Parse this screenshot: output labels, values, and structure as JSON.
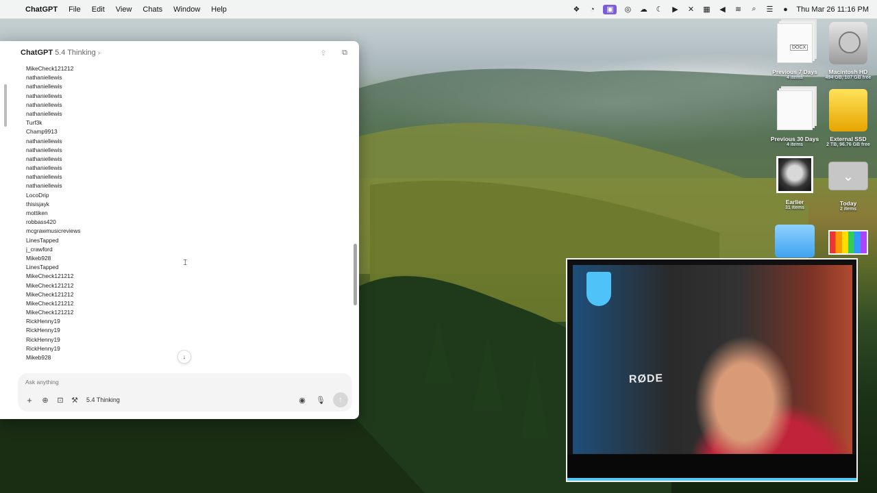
{
  "menubar": {
    "app_name": "ChatGPT",
    "items": [
      "File",
      "Edit",
      "View",
      "Chats",
      "Window",
      "Help"
    ],
    "clock": "Thu Mar 26  11:16 PM"
  },
  "chat": {
    "title": "ChatGPT",
    "model": "5.4 Thinking",
    "usernames": [
      "MikeCheck121212",
      "nathaniellewis",
      "nathaniellewis",
      "nathaniellewis",
      "nathaniellewis",
      "nathaniellewis",
      "Turf3k",
      "Champ9913",
      "nathaniellewis",
      "nathaniellewis",
      "nathaniellewis",
      "nathaniellewis",
      "nathaniellewis",
      "nathaniellewis",
      "LocoDrip",
      "thisisjayk",
      "mottiken",
      "robbass420",
      "mcgrawmusicreviews",
      "LinesTapped",
      "j_crawford",
      "Mikeb928",
      "LinesTapped",
      "MikeCheck121212",
      "MikeCheck121212",
      "MikeCheck121212",
      "MikeCheck121212",
      "MikeCheck121212",
      "RickHenny19",
      "RickHenny19",
      "RickHenny19",
      "RickHenny19",
      "Mikeb928"
    ],
    "composer": {
      "placeholder": "Ask anything",
      "mode_label": "5.4 Thinking"
    }
  },
  "desktop": {
    "icons": [
      {
        "label": "Previous 7 Days",
        "sub": "4 items",
        "badge": "DOCX"
      },
      {
        "label": "Macintosh HD",
        "sub": "494 GB, 107 GB free"
      },
      {
        "label": "Previous 30 Days",
        "sub": "4 items"
      },
      {
        "label": "External SSD",
        "sub": "2 TB, 96.76 GB free"
      },
      {
        "label": "Earlier",
        "sub": "31 items"
      },
      {
        "label": "Today",
        "sub": "2 items"
      }
    ]
  },
  "webcam": {
    "brand_text": "RØDE"
  }
}
